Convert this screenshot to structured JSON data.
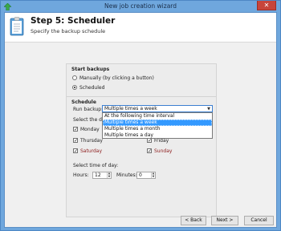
{
  "window": {
    "title": "New job creation wizard",
    "close_label": "✕"
  },
  "header": {
    "title": "Step 5: Scheduler",
    "subtitle": "Specify the backup schedule"
  },
  "start_backups": {
    "label": "Start backups",
    "options": [
      {
        "label": "Manually (by clicking a button)",
        "checked": false
      },
      {
        "label": "Scheduled",
        "checked": true
      }
    ]
  },
  "schedule": {
    "label": "Schedule",
    "run_backup_label": "Run backup:",
    "run_backup_value": "Multiple times a week",
    "dropdown_options": [
      "At the following time interval",
      "Multiple times a week",
      "Multiple times a month",
      "Multiple times a day"
    ],
    "select_days_label": "Select the days",
    "days": [
      {
        "label": "Monday",
        "checked": true,
        "weekend": false
      },
      {
        "label": "Thursday",
        "checked": true,
        "weekend": false
      },
      {
        "label": "Friday",
        "checked": true,
        "weekend": false
      },
      {
        "label": "Saturday",
        "checked": true,
        "weekend": true
      },
      {
        "label": "Sunday",
        "checked": true,
        "weekend": true
      }
    ],
    "check_mark": "✓",
    "time_label": "Select time of day:",
    "hours_label": "Hours:",
    "hours_value": "12",
    "minutes_label": "Minutes:",
    "minutes_value": "0"
  },
  "buttons": {
    "back": "< Back",
    "next": "Next >",
    "cancel": "Cancel"
  },
  "colors": {
    "titlebar": "#6fa7dd",
    "close": "#c7453b",
    "selection": "#3399ff",
    "weekend_text": "#8b1a1a"
  }
}
